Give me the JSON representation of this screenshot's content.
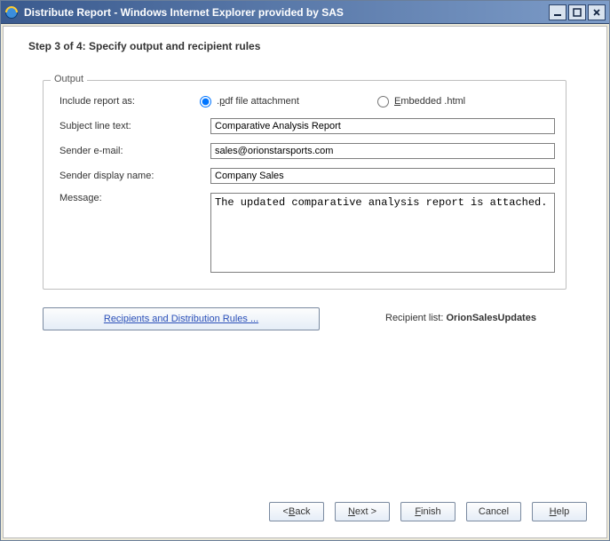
{
  "window": {
    "title": "Distribute Report - Windows Internet Explorer provided by SAS"
  },
  "step": {
    "label": "Step 3 of 4: Specify output and recipient rules"
  },
  "output": {
    "legend": "Output",
    "include_label": "Include report as:",
    "radio_pdf_prefix": ".",
    "radio_pdf_ul": "p",
    "radio_pdf_suffix": "df file attachment",
    "radio_html_prefix": "",
    "radio_html_ul": "E",
    "radio_html_suffix": "mbedded .html",
    "subject_label": "Subject line text:",
    "subject_value": "Comparative Analysis Report",
    "sender_label": "Sender e-mail:",
    "sender_value": "sales@orionstarsports.com",
    "display_label": "Sender display name:",
    "display_value": "Company Sales",
    "message_label": "Message:",
    "message_value": "The updated comparative analysis report is attached."
  },
  "recipients": {
    "button_label": "Recipients and Distribution Rules ...",
    "list_label": "Recipient list: ",
    "list_value": "OrionSalesUpdates"
  },
  "buttons": {
    "back_prefix": "< ",
    "back_ul": "B",
    "back_suffix": "ack",
    "next_prefix": "",
    "next_ul": "N",
    "next_suffix": "ext >",
    "finish_prefix": "",
    "finish_ul": "F",
    "finish_suffix": "inish",
    "cancel": "Cancel",
    "help_prefix": "",
    "help_ul": "H",
    "help_suffix": "elp"
  }
}
